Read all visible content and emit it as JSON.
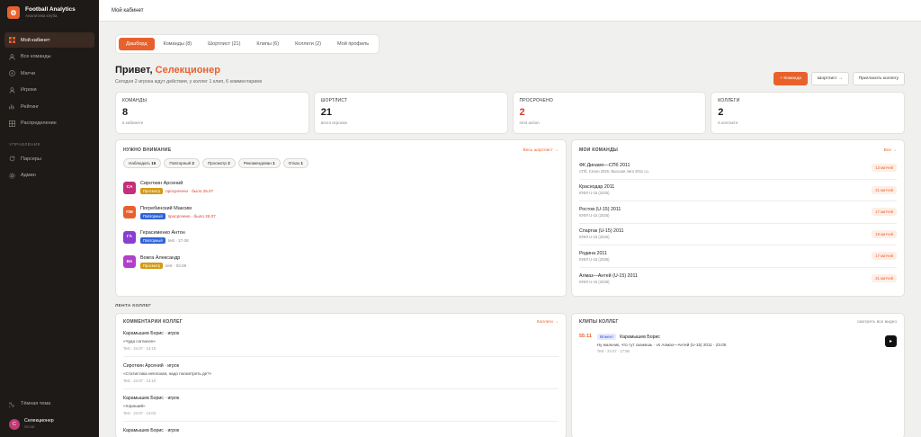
{
  "brand": {
    "title": "Football Analytics",
    "subtitle": "Аналитика клуба"
  },
  "nav": {
    "items": [
      {
        "label": "Мой кабинет",
        "icon": "grid-icon",
        "active": true
      },
      {
        "label": "Все команды",
        "icon": "users-icon"
      },
      {
        "label": "Матчи",
        "icon": "play-circle-icon"
      },
      {
        "label": "Игроки",
        "icon": "user-icon"
      },
      {
        "label": "Рейтинг",
        "icon": "chart-icon"
      },
      {
        "label": "Распределение",
        "icon": "grid-icon"
      }
    ],
    "section_label": "УПРАВЛЕНИЕ",
    "section_items": [
      {
        "label": "Парсеры",
        "icon": "refresh-icon"
      },
      {
        "label": "Админ",
        "icon": "gear-icon"
      }
    ]
  },
  "sidebar_bottom": {
    "theme_label": "Тёмная тема",
    "user_name": "Селекционер",
    "user_role": "Scout",
    "user_initial": "С"
  },
  "topbar": {
    "title": "Мой кабинет"
  },
  "tabs": [
    "Дашборд",
    "Команды (8)",
    "Шортлист (21)",
    "Клипы (6)",
    "Коллеги (2)",
    "Мой профиль"
  ],
  "greeting": {
    "prefix": "Привет, ",
    "name": "Селекционер",
    "subtitle": "Сегодня 2 игрока ждут действия, у коллег 1 клип, 6 комментариев"
  },
  "actions": {
    "primary": "+ Команда",
    "shortlist": "Шортлист →",
    "invite": "Пригласить коллегу"
  },
  "stats": [
    {
      "label": "КОМАНДЫ",
      "value": "8",
      "caption": "в кабинете"
    },
    {
      "label": "ШОРТЛИСТ",
      "value": "21",
      "caption": "всего игроков"
    },
    {
      "label": "ПРОСРОЧЕНО",
      "value": "2",
      "caption": "next action",
      "alert": true
    },
    {
      "label": "КОЛЛЕГИ",
      "value": "2",
      "caption": "в контакте"
    }
  ],
  "attention": {
    "title": "НУЖНО ВНИМАНИЕ",
    "link": "Весь шортлист →",
    "chips": [
      {
        "label": "Наблюдать",
        "count": "16"
      },
      {
        "label": "Повторный",
        "count": "2"
      },
      {
        "label": "Просмотр",
        "count": "2"
      },
      {
        "label": "Рекомендован",
        "count": "1"
      },
      {
        "label": "Отказ",
        "count": "1"
      }
    ],
    "players": [
      {
        "initials": "СА",
        "color": "#c2307a",
        "name": "Сироткин Арсений",
        "badge": "Просмотр",
        "badge_color": "#d49a16",
        "meta": "просрочено · было 25.07",
        "overdue": true
      },
      {
        "initials": "ПМ",
        "color": "#e8612c",
        "name": "Погребинский Максим",
        "badge": "Повторный",
        "badge_color": "#2f63d6",
        "meta": "просрочено · было 26.07",
        "overdue": true
      },
      {
        "initials": "ГА",
        "color": "#8a3fd1",
        "name": "Герасименко Антон",
        "badge": "Повторный",
        "badge_color": "#2f63d6",
        "meta": "test · 27.08",
        "overdue": false
      },
      {
        "initials": "ВА",
        "color": "#b23fc9",
        "name": "Вожга Александр",
        "badge": "Просмотр",
        "badge_color": "#d49a16",
        "meta": "test · 03.08",
        "overdue": false
      }
    ]
  },
  "my_teams": {
    "title": "МОИ КОМАНДЫ",
    "link": "Все →",
    "teams": [
      {
        "name": "ФК Динамо—СПб 2011",
        "sub": "СПб, Сезон 2026, Высшая лига 2011 г.р.",
        "badge": "13 матчей"
      },
      {
        "name": "Краснодар 2011",
        "sub": "ЮФЛ U-15 (2026)",
        "badge": "21 матчей"
      },
      {
        "name": "Ростов (U-15) 2011",
        "sub": "ЮФЛ U-15 (2026)",
        "badge": "17 матчей"
      },
      {
        "name": "Спартак (U-15) 2011",
        "sub": "ЮФЛ U-15 (2026)",
        "badge": "19 матчей"
      },
      {
        "name": "Родина 2011",
        "sub": "ЮФЛ U-15 (2026)",
        "badge": "17 матчей"
      },
      {
        "name": "Алмаз—Антей (U-15) 2011",
        "sub": "ЮФЛ U-15 (2026)",
        "badge": "21 матчей"
      }
    ]
  },
  "feed_title": "ЛЕНТА КОЛЛЕГ",
  "comments": {
    "title": "КОММЕНТАРИИ КОЛЛЕГ",
    "link": "Коллеги →",
    "items": [
      {
        "author": "Карамышев Борис · игрок",
        "quote": "«Чуда согласен»",
        "date": "Test · 24.07 · 14:16"
      },
      {
        "author": "Сироткин Арсений · игрок",
        "quote": "«Статистика неплохая, надо посмотреть де?»",
        "date": "Test · 24.07 · 14:10"
      },
      {
        "author": "Карамышев Борис · игрок",
        "quote": "«Хороший»",
        "date": "Test · 24.07 · 14:03"
      },
      {
        "author": "Карамышев Борис · игрок",
        "quote": "",
        "date": ""
      }
    ]
  },
  "clips": {
    "title": "КЛИПЫ КОЛЛЕГ",
    "link": "смотреть все видео",
    "items": [
      {
        "time": "55:11",
        "badge": "Момент",
        "author": "Карамышев Борис",
        "text": "Ну мальчик, что тут скажешь · vs Алмаз—Антей (U-15) 2011 · 23.05",
        "date": "Test · 24.07 · 17:56"
      }
    ]
  },
  "colors": {
    "accent": "#e8612c",
    "sidebar": "#1d1a18",
    "alert": "#d63b2a"
  }
}
